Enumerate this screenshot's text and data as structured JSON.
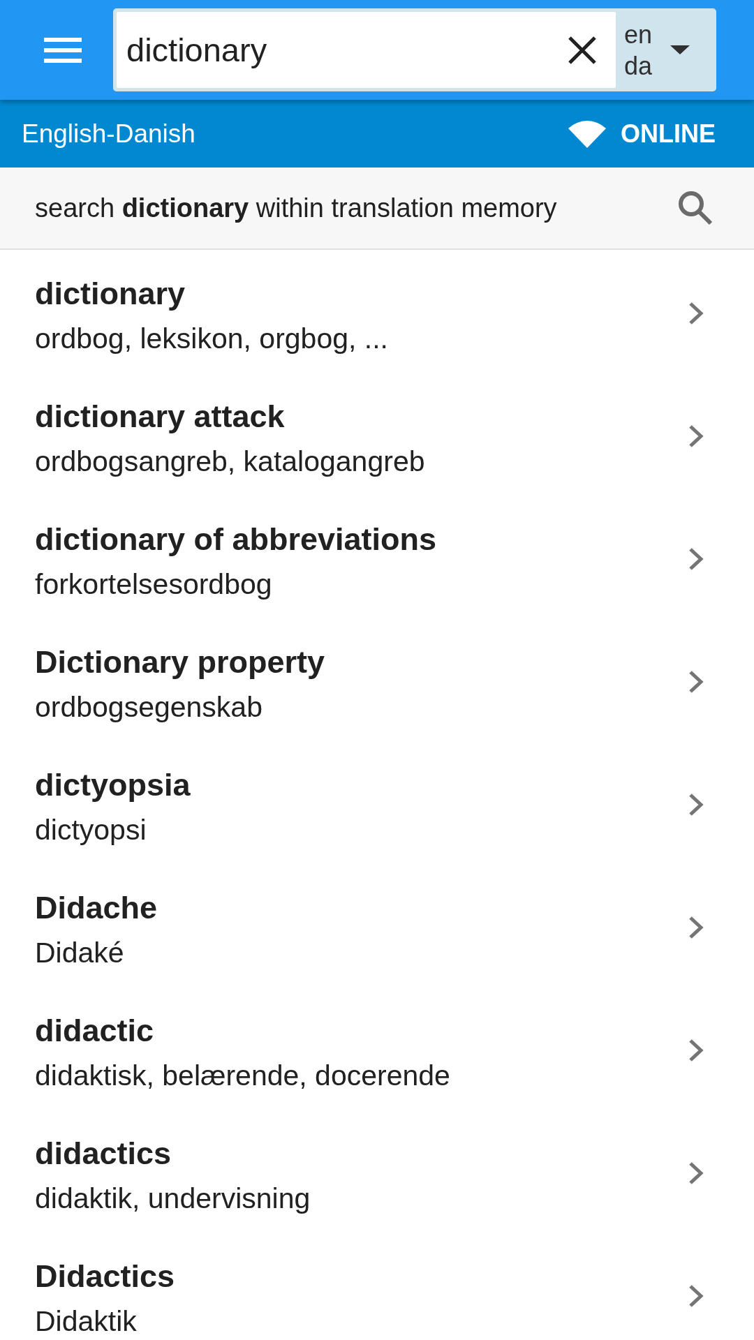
{
  "app_bar": {
    "search": {
      "value": "dictionary"
    },
    "language_pair": {
      "source": "en",
      "target": "da"
    }
  },
  "status_bar": {
    "dictionary": "English-Danish",
    "connection": "ONLINE"
  },
  "memory_search": {
    "text": "search **dictionary** within translation memory"
  },
  "results": [
    {
      "term": "dictionary",
      "translations": "ordbog, leksikon, orgbog, ..."
    },
    {
      "term": "dictionary attack",
      "translations": "ordbogsangreb, katalogangreb"
    },
    {
      "term": "dictionary of abbreviations",
      "translations": "forkortelsesordbog"
    },
    {
      "term": "Dictionary property",
      "translations": "ordbogsegenskab"
    },
    {
      "term": "dictyopsia",
      "translations": "dictyopsi"
    },
    {
      "term": "Didache",
      "translations": "Didaké"
    },
    {
      "term": "didactic",
      "translations": "didaktisk, belærende, docerende"
    },
    {
      "term": "didactics",
      "translations": "didaktik, undervisning"
    },
    {
      "term": "Didactics",
      "translations": "Didaktik"
    }
  ]
}
